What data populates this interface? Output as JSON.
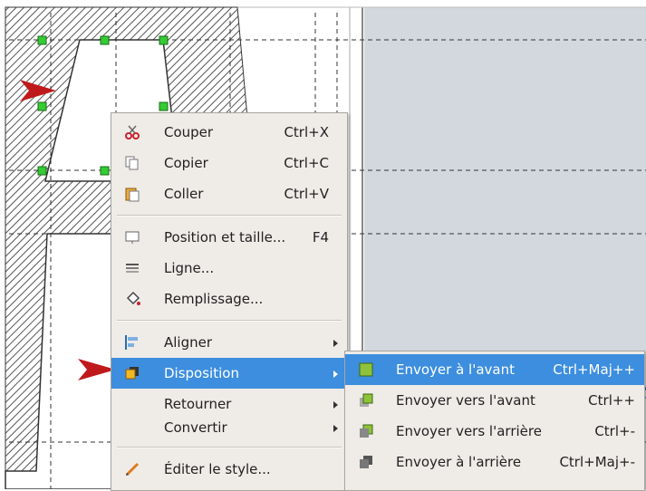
{
  "context_menu": {
    "items": [
      {
        "label": "Couper",
        "shortcut": "Ctrl+X",
        "icon": "scissors-icon"
      },
      {
        "label": "Copier",
        "shortcut": "Ctrl+C",
        "icon": "copy-icon"
      },
      {
        "label": "Coller",
        "shortcut": "Ctrl+V",
        "icon": "paste-icon"
      },
      {
        "label": "Position et taille...",
        "shortcut": "F4",
        "icon": "position-size-icon"
      },
      {
        "label": "Ligne...",
        "shortcut": "",
        "icon": "line-icon"
      },
      {
        "label": "Remplissage...",
        "shortcut": "",
        "icon": "fill-bucket-icon"
      },
      {
        "label": "Aligner",
        "shortcut": "",
        "icon": "align-icon"
      },
      {
        "label": "Disposition",
        "shortcut": "",
        "icon": "arrange-icon"
      },
      {
        "label": "Retourner",
        "shortcut": "",
        "icon": ""
      },
      {
        "label": "Convertir",
        "shortcut": "",
        "icon": ""
      },
      {
        "label": "Éditer le style...",
        "shortcut": "",
        "icon": "pencil-icon"
      }
    ]
  },
  "submenu": {
    "items": [
      {
        "label": "Envoyer à l'avant",
        "shortcut": "Ctrl+Maj++",
        "icon": "bring-to-front-icon"
      },
      {
        "label": "Envoyer vers l'avant",
        "shortcut": "Ctrl++",
        "icon": "bring-forward-icon"
      },
      {
        "label": "Envoyer vers l'arrière",
        "shortcut": "Ctrl+-",
        "icon": "send-backward-icon"
      },
      {
        "label": "Envoyer à l'arrière",
        "shortcut": "Ctrl+Maj+-",
        "icon": "send-to-back-icon"
      }
    ]
  },
  "colors": {
    "highlight": "#3d8ede",
    "menu_bg": "#efebe7",
    "annotation_arrow": "#c0191b",
    "handle": "#33cc33",
    "page_bg": "#d3d8df"
  }
}
